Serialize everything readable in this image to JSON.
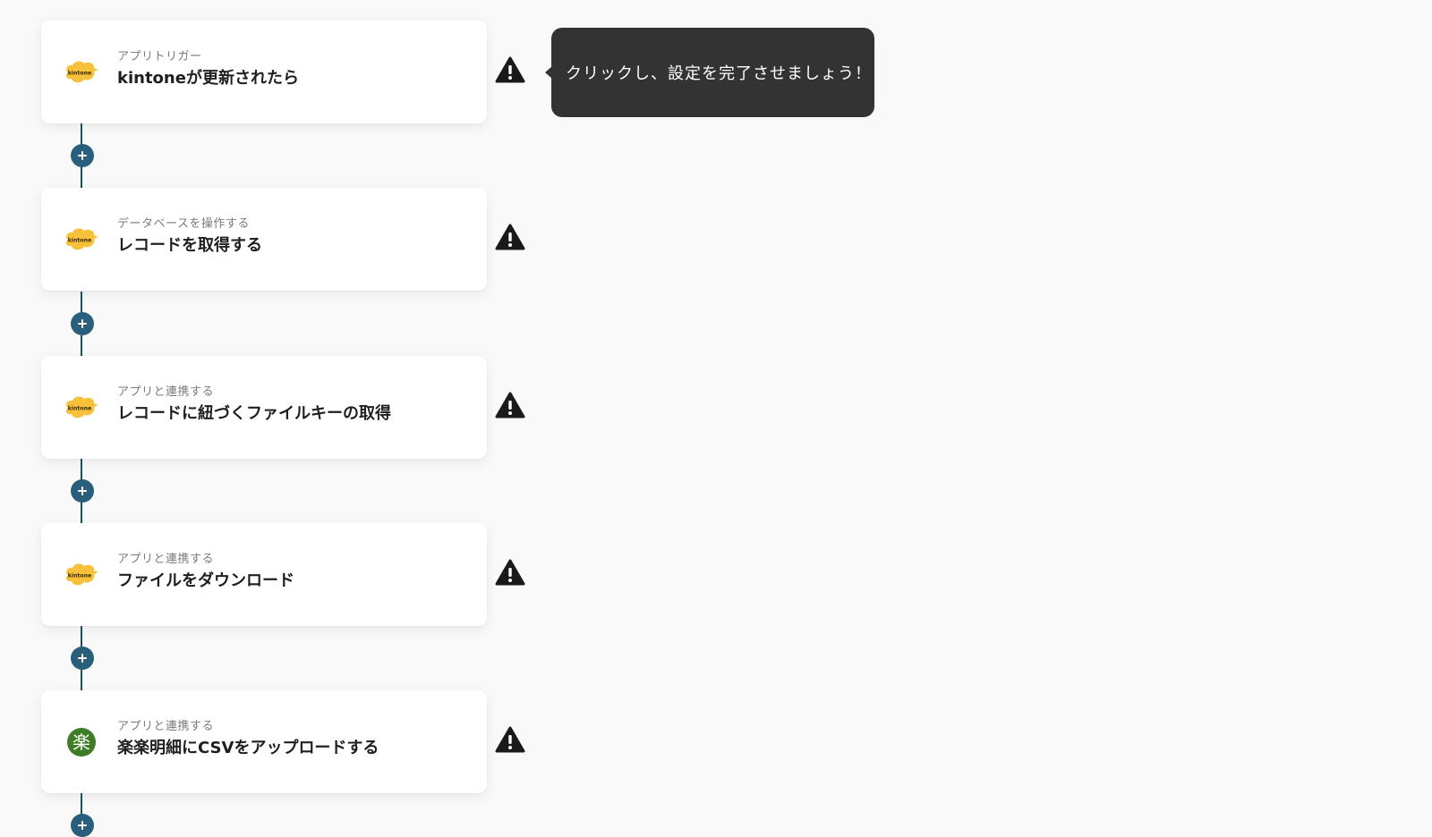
{
  "flow": {
    "steps": [
      {
        "category": "アプリトリガー",
        "title": "kintoneが更新されたら",
        "app_icon": "kintone-icon",
        "app_icon_text": "kintone"
      },
      {
        "category": "データベースを操作する",
        "title": "レコードを取得する",
        "app_icon": "kintone-icon",
        "app_icon_text": "kintone"
      },
      {
        "category": "アプリと連携する",
        "title": "レコードに紐づくファイルキーの取得",
        "app_icon": "kintone-icon",
        "app_icon_text": "kintone"
      },
      {
        "category": "アプリと連携する",
        "title": "ファイルをダウンロード",
        "app_icon": "kintone-icon",
        "app_icon_text": "kintone"
      },
      {
        "category": "アプリと連携する",
        "title": "楽楽明細にCSVをアップロードする",
        "app_icon": "rakuraku-icon",
        "app_icon_text": "楽"
      }
    ],
    "add_step_symbol": "+",
    "warning_icon": "warning-triangle-icon"
  },
  "tooltip": {
    "text": "クリックし、設定を完了させましょう！"
  },
  "colors": {
    "background": "#f9f9f9",
    "card": "#ffffff",
    "connector": "#1e4d66",
    "add_button": "#2a5f7c",
    "kintone_yellow": "#f8c13b",
    "rakuraku_green": "#3e7d25",
    "tooltip_bg": "#333333",
    "warning": "#1a1a1a"
  }
}
